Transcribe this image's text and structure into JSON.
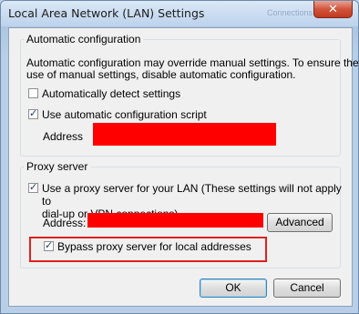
{
  "window": {
    "title": "Local Area Network (LAN) Settings",
    "background_title": "Connections",
    "close_glyph": "✕"
  },
  "auto_config": {
    "group_title": "Automatic configuration",
    "description_line1": "Automatic configuration may override manual settings.  To ensure the",
    "description_line2": "use of manual settings, disable automatic configuration.",
    "detect_label": "Automatically detect settings",
    "detect_checked": false,
    "script_label": "Use automatic configuration script",
    "script_checked": true,
    "address_label": "Address"
  },
  "proxy": {
    "group_title": "Proxy server",
    "use_proxy_line1": "Use a proxy server for your LAN (These settings will not apply to",
    "use_proxy_line2": "dial-up or VPN connections).",
    "use_proxy_checked": true,
    "address_label": "Address:",
    "advanced_label": "Advanced",
    "bypass_label": "Bypass proxy server for local addresses",
    "bypass_checked": true
  },
  "buttons": {
    "ok": "OK",
    "cancel": "Cancel"
  },
  "colors": {
    "redaction": "#ff0000",
    "highlight": "#e02020"
  }
}
